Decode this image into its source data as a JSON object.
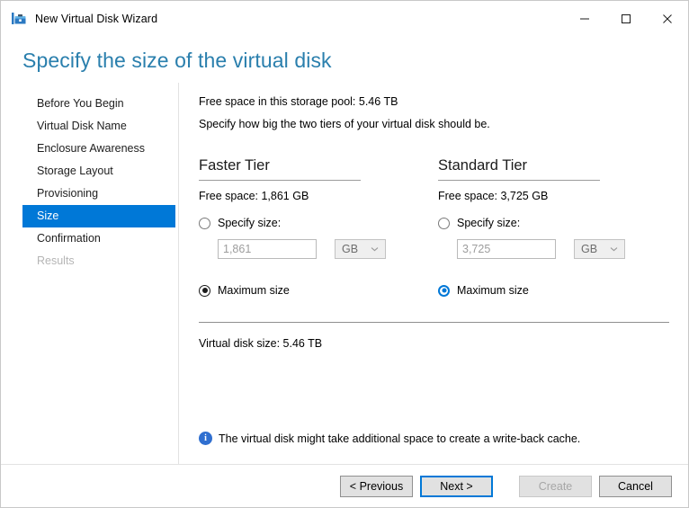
{
  "window": {
    "title": "New Virtual Disk Wizard",
    "app_icon": "virtual-disk-wizard-icon",
    "controls": {
      "minimize": "minimize-icon",
      "maximize": "maximize-icon",
      "close": "close-icon"
    }
  },
  "heading": "Specify the size of the virtual disk",
  "sidebar": {
    "items": [
      {
        "label": "Before You Begin",
        "state": "normal"
      },
      {
        "label": "Virtual Disk Name",
        "state": "normal"
      },
      {
        "label": "Enclosure Awareness",
        "state": "normal"
      },
      {
        "label": "Storage Layout",
        "state": "normal"
      },
      {
        "label": "Provisioning",
        "state": "normal"
      },
      {
        "label": "Size",
        "state": "selected"
      },
      {
        "label": "Confirmation",
        "state": "normal"
      },
      {
        "label": "Results",
        "state": "disabled"
      }
    ]
  },
  "main": {
    "free_space_line": "Free space in this storage pool: 5.46 TB",
    "instruction_line": "Specify how big the two tiers of your virtual disk should be.",
    "tiers": [
      {
        "title": "Faster Tier",
        "free_space": "Free space: 1,861 GB",
        "specify_label": "Specify size:",
        "specify_selected": false,
        "size_value": "1,861",
        "unit": "GB",
        "maximum_label": "Maximum size",
        "maximum_selected": true,
        "maximum_focused": false
      },
      {
        "title": "Standard Tier",
        "free_space": "Free space: 3,725 GB",
        "specify_label": "Specify size:",
        "specify_selected": false,
        "size_value": "3,725",
        "unit": "GB",
        "maximum_label": "Maximum size",
        "maximum_selected": true,
        "maximum_focused": true
      }
    ],
    "virtual_disk_size": "Virtual disk size: 5.46 TB",
    "note": "The virtual disk might take additional space to create a write-back cache.",
    "note_icon": "info-icon"
  },
  "footer": {
    "previous": "< Previous",
    "next": "Next >",
    "create": "Create",
    "cancel": "Cancel"
  },
  "colors": {
    "accent": "#0078d7",
    "heading": "#2a7fad",
    "info": "#2f6fd0"
  }
}
